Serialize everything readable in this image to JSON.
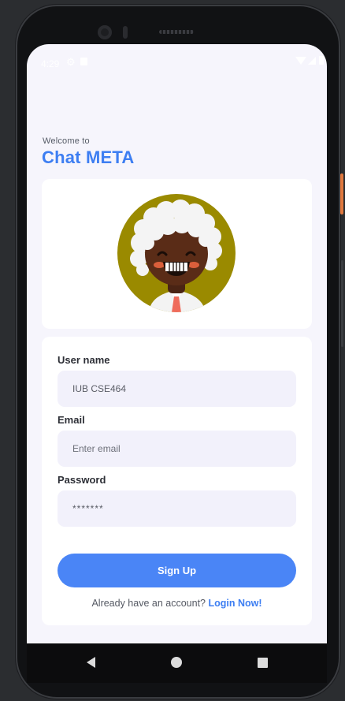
{
  "status_bar": {
    "time": "4:29"
  },
  "header": {
    "welcome": "Welcome to",
    "title": "Chat META"
  },
  "form": {
    "username_label": "User name",
    "username_value": "IUB CSE464",
    "email_label": "Email",
    "email_placeholder": "Enter email",
    "password_label": "Password",
    "password_value": "*******",
    "signup_label": "Sign Up",
    "already_text": "Already have an account?",
    "login_text": "Login Now!"
  },
  "colors": {
    "accent": "#3d7ef2",
    "button": "#4a85f6",
    "screen_bg": "#f6f5fc",
    "avatar_bg": "#9a8a00"
  },
  "icons": {
    "status": [
      "gear-icon",
      "sim-card-icon",
      "wifi-icon",
      "signal-icon",
      "battery-icon"
    ],
    "navigation": [
      "back-icon",
      "home-icon",
      "recents-icon"
    ]
  }
}
